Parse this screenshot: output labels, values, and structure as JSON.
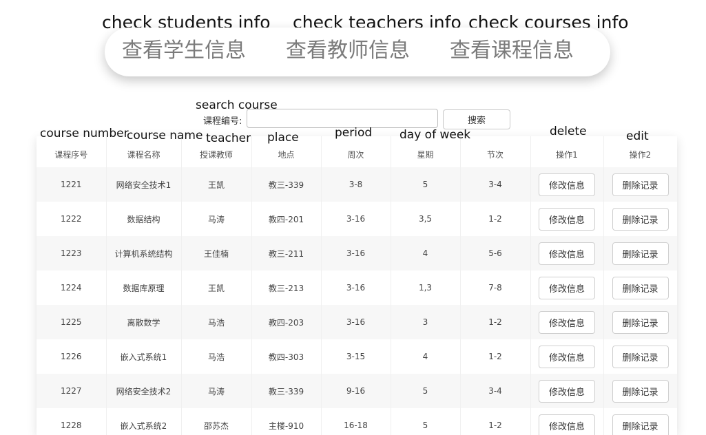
{
  "annotations": {
    "nav": [
      "check students info",
      "check teachers info",
      "check courses info"
    ],
    "search": "search course",
    "columns": [
      "course number",
      "course name",
      "teacher",
      "place",
      "period",
      "day of week",
      "delete",
      "edit"
    ]
  },
  "nav": {
    "items": [
      "查看学生信息",
      "查看教师信息",
      "查看课程信息"
    ]
  },
  "search": {
    "label": "课程编号:",
    "value": "",
    "placeholder": "",
    "button_label": "搜索"
  },
  "table": {
    "headers": [
      "课程序号",
      "课程名称",
      "授课教师",
      "地点",
      "周次",
      "星期",
      "节次",
      "操作1",
      "操作2"
    ],
    "rows": [
      {
        "id": "1221",
        "name": "网络安全技术1",
        "teacher": "王凯",
        "place": "教三-339",
        "weeks": "3-8",
        "day": "5",
        "period": "3-4",
        "op1": "修改信息",
        "op2": "删除记录"
      },
      {
        "id": "1222",
        "name": "数据结构",
        "teacher": "马涛",
        "place": "教四-201",
        "weeks": "3-16",
        "day": "3,5",
        "period": "1-2",
        "op1": "修改信息",
        "op2": "删除记录"
      },
      {
        "id": "1223",
        "name": "计算机系统结构",
        "teacher": "王佳楠",
        "place": "教三-211",
        "weeks": "3-16",
        "day": "4",
        "period": "5-6",
        "op1": "修改信息",
        "op2": "删除记录"
      },
      {
        "id": "1224",
        "name": "数据库原理",
        "teacher": "王凯",
        "place": "教三-213",
        "weeks": "3-16",
        "day": "1,3",
        "period": "7-8",
        "op1": "修改信息",
        "op2": "删除记录"
      },
      {
        "id": "1225",
        "name": "离散数学",
        "teacher": "马浩",
        "place": "教四-203",
        "weeks": "3-16",
        "day": "3",
        "period": "1-2",
        "op1": "修改信息",
        "op2": "删除记录"
      },
      {
        "id": "1226",
        "name": "嵌入式系统1",
        "teacher": "马浩",
        "place": "教四-303",
        "weeks": "3-15",
        "day": "4",
        "period": "1-2",
        "op1": "修改信息",
        "op2": "删除记录"
      },
      {
        "id": "1227",
        "name": "网络安全技术2",
        "teacher": "马涛",
        "place": "教三-339",
        "weeks": "9-16",
        "day": "5",
        "period": "3-4",
        "op1": "修改信息",
        "op2": "删除记录"
      },
      {
        "id": "1228",
        "name": "嵌入式系统2",
        "teacher": "邵苏杰",
        "place": "主楼-910",
        "weeks": "16-18",
        "day": "5",
        "period": "1-2",
        "op1": "修改信息",
        "op2": "删除记录"
      }
    ]
  }
}
